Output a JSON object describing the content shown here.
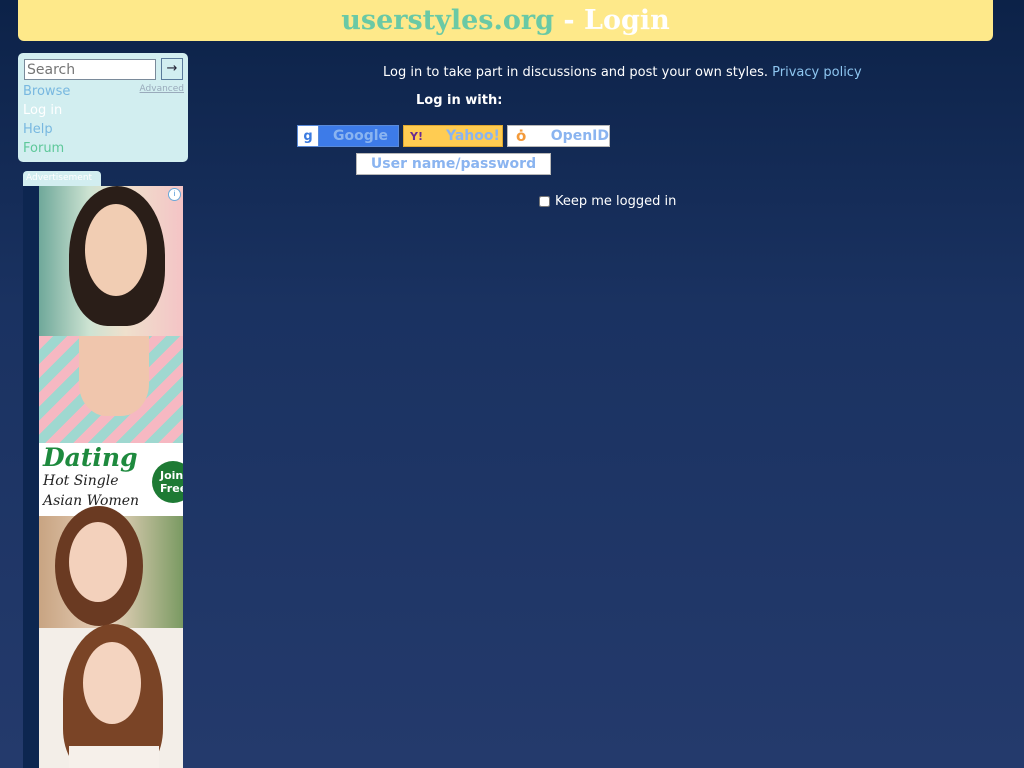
{
  "header": {
    "site": "userstyles.org",
    "separator": " - ",
    "page": "Login"
  },
  "sidebar": {
    "search_placeholder": "Search",
    "search_button": "→",
    "advanced_label": "Advanced",
    "items": [
      {
        "label": "Browse"
      },
      {
        "label": "Log in"
      },
      {
        "label": "Help"
      },
      {
        "label": "Forum"
      }
    ]
  },
  "ad": {
    "tab_label": "Advertisement",
    "headline": "Dating",
    "line2": "Hot Single",
    "line3": "Asian Women",
    "join_line1": "Join",
    "join_line2": "Free"
  },
  "main": {
    "intro_text": "Log in to take part in discussions and post your own styles. ",
    "privacy_link": "Privacy policy",
    "login_with_label": "Log in with:",
    "providers": [
      {
        "label": "Google"
      },
      {
        "label": "Yahoo!"
      },
      {
        "label": "OpenID"
      }
    ],
    "userpass_label": "User name/password",
    "keep_logged_in_label": "Keep me logged in"
  },
  "colors": {
    "banner_bg": "#fee98a",
    "site_name": "#6ac9a5",
    "link": "#8ec6f0",
    "page_bg_top": "#0c2248",
    "page_bg_bottom": "#243a6c"
  }
}
